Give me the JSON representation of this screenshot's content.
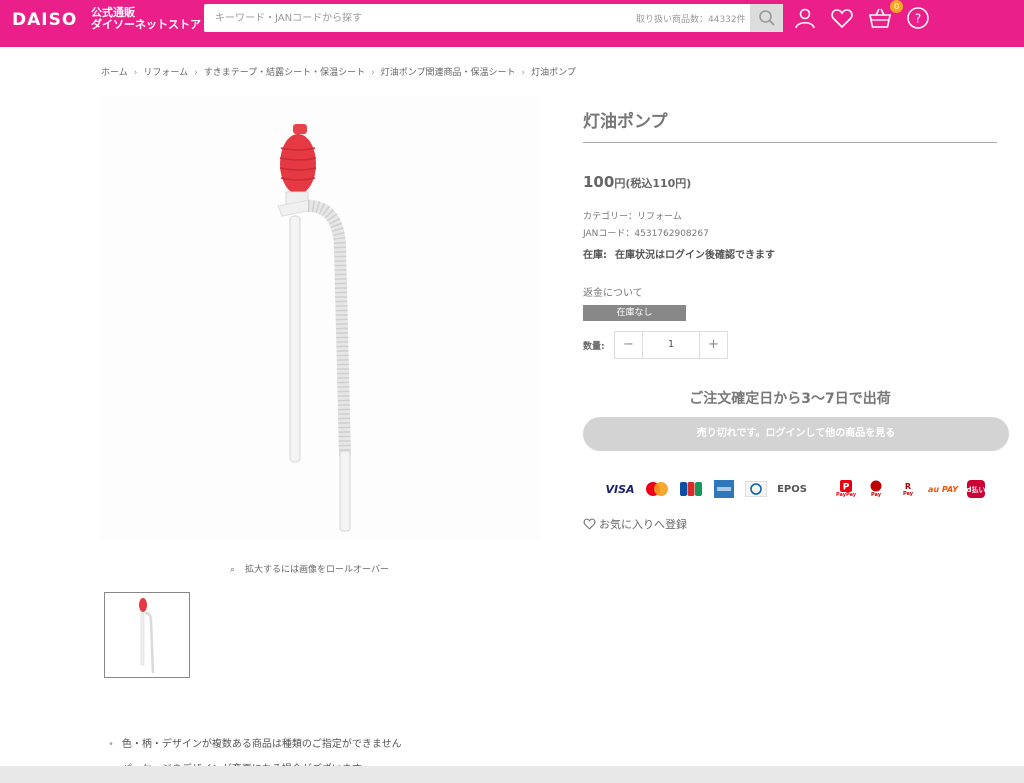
{
  "header": {
    "logo_text": "DAISO",
    "logo_sub_line1": "公式通販",
    "logo_sub_line2": "ダイソーネットストア",
    "search_placeholder": "キーワード・JANコードから探す",
    "search_count": "取り扱い商品数：44332件",
    "cart_count": "0",
    "brand_color": "#ea1f8a"
  },
  "breadcrumb": [
    "ホーム",
    "リフォーム",
    "すきまテープ・結露シート・保温シート",
    "灯油ポンプ関連商品・保温シート",
    "灯油ポンプ"
  ],
  "gallery": {
    "zoom_hint": "拡大するには画像をロールオーバー"
  },
  "product": {
    "title": "灯油ポンプ",
    "price": "100",
    "price_unit": "円",
    "price_tax": "(税込110円)",
    "category": "カテゴリー：リフォーム",
    "jan": "JANコード：4531762908267",
    "stock_label": "在庫:",
    "stock_text": "在庫状況はログイン後確認できます",
    "refund": "返金について",
    "out_of_stock": "在庫なし",
    "qty_label": "数量:",
    "qty_value": "1",
    "qty_minus": "−",
    "qty_plus": "+",
    "shipping": "ご注文確定日から3〜7日で出荷",
    "soldout_button": "売り切れです。ログインして他の商品を見る",
    "favorite": "お気に入りへ登録"
  },
  "payments": [
    "VISA",
    "Mastercard",
    "JCB",
    "AMEX",
    "Diners",
    "EPOS",
    "PayPay",
    "RakutenPay",
    "楽天ペイ",
    "au PAY",
    "d払い"
  ],
  "payment_labels": {
    "visa": "VISA",
    "epos": "EPOS",
    "paypay": "PayPay",
    "pay": "Pay",
    "aupay": "au PAY",
    "dpay": "d払い"
  },
  "notes": [
    "色・柄・デザインが複数ある商品は種類のご指定ができません",
    "パッケージのデザインが変更になる場合がございます"
  ]
}
